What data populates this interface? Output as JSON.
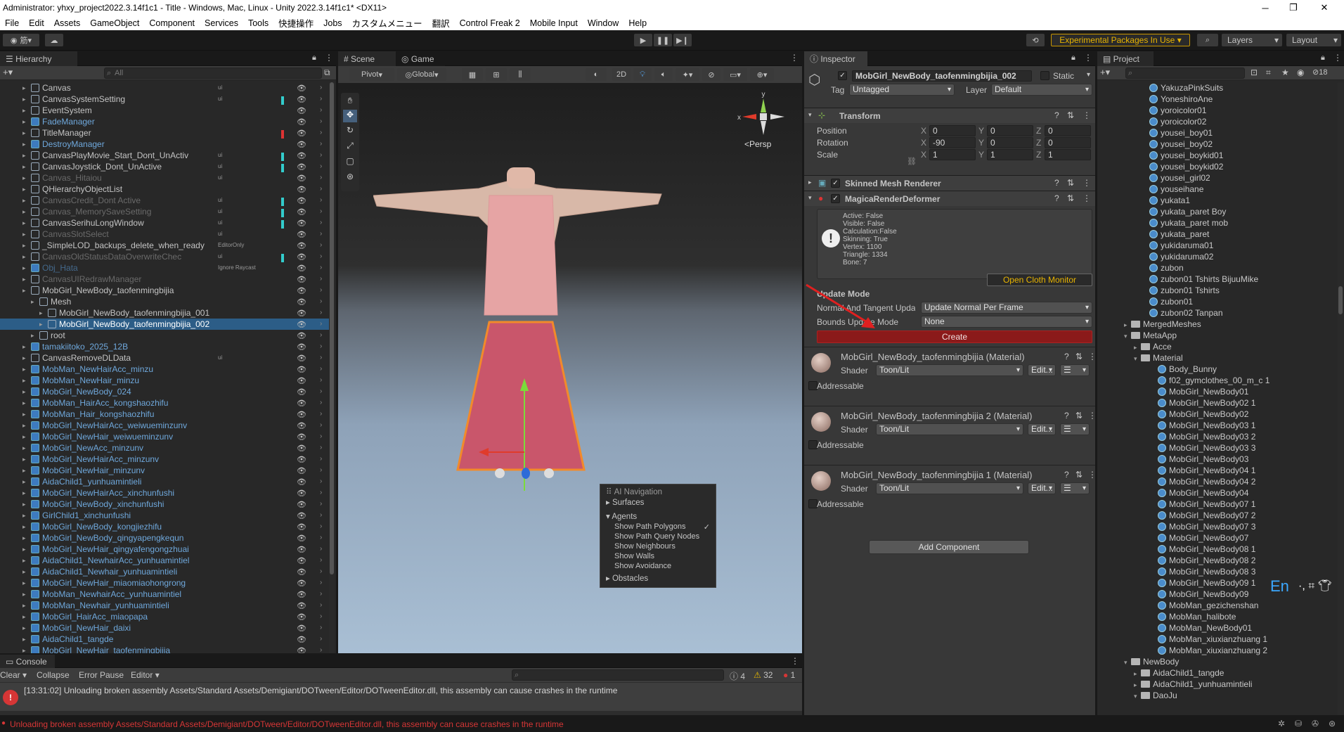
{
  "window": {
    "title": "Administrator: yhxy_project2022.3.14f1c1 - Title - Windows, Mac, Linux - Unity 2022.3.14f1c1* <DX11>"
  },
  "menu": [
    "File",
    "Edit",
    "Assets",
    "GameObject",
    "Component",
    "Services",
    "Tools",
    "快捷操作",
    "Jobs",
    "カスタムメニュー",
    "翻訳",
    "Control Freak 2",
    "Mobile Input",
    "Window",
    "Help"
  ],
  "toolbar": {
    "experimental": "Experimental Packages In Use",
    "layers": "Layers",
    "layout": "Layout",
    "account": "筋"
  },
  "hierarchy": {
    "tab": "Hierarchy",
    "search_placeholder": "All",
    "rows": [
      {
        "label": "Canvas",
        "indent": 0,
        "style": "normal",
        "tag": "ui",
        "bar": ""
      },
      {
        "label": "CanvasSystemSetting",
        "indent": 0,
        "style": "normal",
        "tag": "ui",
        "bar": "#3cc"
      },
      {
        "label": "EventSystem",
        "indent": 0,
        "style": "normal",
        "tag": "",
        "bar": ""
      },
      {
        "label": "FadeManager",
        "indent": 0,
        "style": "prefab",
        "tag": "",
        "bar": ""
      },
      {
        "label": "TitleManager",
        "indent": 0,
        "style": "normal",
        "tag": "",
        "bar": "#d33"
      },
      {
        "label": "DestroyManager",
        "indent": 0,
        "style": "prefab",
        "tag": "",
        "bar": ""
      },
      {
        "label": "CanvasPlayMovie_Start_Dont_UnActiv",
        "indent": 0,
        "style": "normal",
        "tag": "ui",
        "bar": "#3cc"
      },
      {
        "label": "CanvasJoystick_Dont_UnActive",
        "indent": 0,
        "style": "normal",
        "tag": "ui",
        "bar": "#3cc"
      },
      {
        "label": "Canvas_Hitaiou",
        "indent": 0,
        "style": "dim",
        "tag": "ui",
        "bar": ""
      },
      {
        "label": "QHierarchyObjectList",
        "indent": 0,
        "style": "normal",
        "tag": "",
        "bar": ""
      },
      {
        "label": "CanvasCredit_Dont Active",
        "indent": 0,
        "style": "dim",
        "tag": "ui",
        "bar": "#3cc"
      },
      {
        "label": "Canvas_MemorySaveSetting",
        "indent": 0,
        "style": "dim",
        "tag": "ui",
        "bar": "#3cc"
      },
      {
        "label": "CanvasSerihuLongWindow",
        "indent": 0,
        "style": "normal",
        "tag": "ui",
        "bar": "#3cc"
      },
      {
        "label": "CanvasSlotSelect",
        "indent": 0,
        "style": "dim",
        "tag": "ui",
        "bar": ""
      },
      {
        "label": "_SimpleLOD_backups_delete_when_ready",
        "indent": 0,
        "style": "normal",
        "tag": "EditorOnly",
        "bar": ""
      },
      {
        "label": "CanvasOldStatusDataOverwriteChec",
        "indent": 0,
        "style": "dim",
        "tag": "ui",
        "bar": "#3cc"
      },
      {
        "label": "Obj_Hata",
        "indent": 0,
        "style": "dimblue",
        "tag": "Ignore Raycast",
        "bar": ""
      },
      {
        "label": "CanvasUIRedrawManager",
        "indent": 0,
        "style": "dim",
        "tag": "",
        "bar": ""
      },
      {
        "label": "MobGirl_NewBody_taofenmingbijia",
        "indent": 0,
        "style": "normal",
        "tag": "",
        "bar": ""
      },
      {
        "label": "Mesh",
        "indent": 1,
        "style": "normal",
        "tag": "",
        "bar": ""
      },
      {
        "label": "MobGirl_NewBody_taofenmingbijia_001",
        "indent": 2,
        "style": "normal",
        "tag": "",
        "bar": ""
      },
      {
        "label": "MobGirl_NewBody_taofenmingbijia_002",
        "indent": 2,
        "style": "selected",
        "tag": "",
        "bar": ""
      },
      {
        "label": "root",
        "indent": 1,
        "style": "normal",
        "tag": "",
        "bar": ""
      },
      {
        "label": "tamakiitoko_2025_12B",
        "indent": 0,
        "style": "prefab",
        "tag": "",
        "bar": ""
      },
      {
        "label": "CanvasRemoveDLData",
        "indent": 0,
        "style": "normal",
        "tag": "ui",
        "bar": ""
      },
      {
        "label": "MobMan_NewHairAcc_minzu",
        "indent": 0,
        "style": "prefab",
        "tag": "",
        "bar": ""
      },
      {
        "label": "MobMan_NewHair_minzu",
        "indent": 0,
        "style": "prefab",
        "tag": "",
        "bar": ""
      },
      {
        "label": "MobGirl_NewBody_024",
        "indent": 0,
        "style": "prefab",
        "tag": "",
        "bar": ""
      },
      {
        "label": "MobMan_HairAcc_kongshaozhifu",
        "indent": 0,
        "style": "prefab",
        "tag": "",
        "bar": ""
      },
      {
        "label": "MobMan_Hair_kongshaozhifu",
        "indent": 0,
        "style": "prefab",
        "tag": "",
        "bar": ""
      },
      {
        "label": "MobGirl_NewHairAcc_weiwueminzunv",
        "indent": 0,
        "style": "prefab",
        "tag": "",
        "bar": ""
      },
      {
        "label": "MobGirl_NewHair_weiwueminzunv",
        "indent": 0,
        "style": "prefab",
        "tag": "",
        "bar": ""
      },
      {
        "label": "MobGirl_NewAcc_minzunv",
        "indent": 0,
        "style": "prefab",
        "tag": "",
        "bar": ""
      },
      {
        "label": "MobGirl_NewHairAcc_minzunv",
        "indent": 0,
        "style": "prefab",
        "tag": "",
        "bar": ""
      },
      {
        "label": "MobGirl_NewHair_minzunv",
        "indent": 0,
        "style": "prefab",
        "tag": "",
        "bar": ""
      },
      {
        "label": "AidaChild1_yunhuamintieli",
        "indent": 0,
        "style": "prefab",
        "tag": "",
        "bar": ""
      },
      {
        "label": "MobGirl_NewHairAcc_xinchunfushi",
        "indent": 0,
        "style": "prefab",
        "tag": "",
        "bar": ""
      },
      {
        "label": "MobGirl_NewBody_xinchunfushi",
        "indent": 0,
        "style": "prefab",
        "tag": "",
        "bar": ""
      },
      {
        "label": "GirlChild1_xinchunfushi",
        "indent": 0,
        "style": "prefab",
        "tag": "",
        "bar": ""
      },
      {
        "label": "MobGirl_NewBody_kongjiezhifu",
        "indent": 0,
        "style": "prefab",
        "tag": "",
        "bar": ""
      },
      {
        "label": "MobGirl_NewBody_qingyapengkequn",
        "indent": 0,
        "style": "prefab",
        "tag": "",
        "bar": ""
      },
      {
        "label": "MobGirl_NewHair_qingyafengongzhuai",
        "indent": 0,
        "style": "prefab",
        "tag": "",
        "bar": ""
      },
      {
        "label": "AidaChild1_NewhairAcc_yunhuamintiel",
        "indent": 0,
        "style": "prefab",
        "tag": "",
        "bar": ""
      },
      {
        "label": "AidaChild1_Newhair_yunhuamintieli",
        "indent": 0,
        "style": "prefab",
        "tag": "",
        "bar": ""
      },
      {
        "label": "MobGirl_NewHair_miaomiaohongrong",
        "indent": 0,
        "style": "prefab",
        "tag": "",
        "bar": ""
      },
      {
        "label": "MobMan_NewhairAcc_yunhuamintiel",
        "indent": 0,
        "style": "prefab",
        "tag": "",
        "bar": ""
      },
      {
        "label": "MobMan_Newhair_yunhuamintieli",
        "indent": 0,
        "style": "prefab",
        "tag": "",
        "bar": ""
      },
      {
        "label": "MobGirl_HairAcc_miaopapa",
        "indent": 0,
        "style": "prefab",
        "tag": "",
        "bar": ""
      },
      {
        "label": "MobGirl_NewHair_daixi",
        "indent": 0,
        "style": "prefab",
        "tag": "",
        "bar": ""
      },
      {
        "label": "AidaChild1_tangde",
        "indent": 0,
        "style": "prefab",
        "tag": "",
        "bar": ""
      },
      {
        "label": "MobGirl_NewHair_taofenmingbijia",
        "indent": 0,
        "style": "prefab",
        "tag": "",
        "bar": ""
      }
    ]
  },
  "scene": {
    "tabs": [
      "Scene",
      "Game"
    ],
    "pivot": "Pivot",
    "global": "Global",
    "mode_2d": "2D",
    "persp": "<Persp",
    "nav_overlay": {
      "title": "AI Navigation",
      "surfaces": "Surfaces",
      "agents": "Agents",
      "items": [
        "Show Path Polygons",
        "Show Path Query Nodes",
        "Show Neighbours",
        "Show Walls",
        "Show Avoidance"
      ],
      "obstacles": "Obstacles"
    }
  },
  "inspector": {
    "tab": "Inspector",
    "object_name": "MobGirl_NewBody_taofenmingbijia_002",
    "static": "Static",
    "tag_label": "Tag",
    "tag_value": "Untagged",
    "layer_label": "Layer",
    "layer_value": "Default",
    "transform": {
      "title": "Transform",
      "rows": [
        {
          "label": "Position",
          "x": "0",
          "y": "0",
          "z": "0"
        },
        {
          "label": "Rotation",
          "x": "-90",
          "y": "0",
          "z": "0"
        },
        {
          "label": "Scale",
          "x": "1",
          "y": "1",
          "z": "1"
        }
      ]
    },
    "skinned": "Skinned Mesh Renderer",
    "magica": "MagicaRenderDeformer",
    "status_lines": [
      "Active: False",
      "Visible: False",
      "Calculation:False",
      "Skinning: True",
      "Vertex: 1100",
      "Triangle: 1334",
      "Bone: 7"
    ],
    "open_cloth": "Open Cloth Monitor",
    "update_mode": "Update Mode",
    "normal_label": "Normal And Tangent Upda",
    "normal_value": "Update Normal Per Frame",
    "bounds_label": "Bounds Update Mode",
    "bounds_value": "None",
    "create": "Create",
    "materials": [
      {
        "name": "MobGirl_NewBody_taofenmingbijia (Material)",
        "shader": "Toon/Lit"
      },
      {
        "name": "MobGirl_NewBody_taofenmingbijia 2 (Material)",
        "shader": "Toon/Lit"
      },
      {
        "name": "MobGirl_NewBody_taofenmingbijia 1 (Material)",
        "shader": "Toon/Lit"
      }
    ],
    "shader_label": "Shader",
    "edit": "Edit...",
    "addressable": "Addressable",
    "add_component": "Add Component"
  },
  "project": {
    "tab": "Project",
    "count": "18",
    "items": [
      {
        "label": "YakuzaPinkSuits",
        "type": "asset",
        "indent": 2
      },
      {
        "label": "YoneshiroAne",
        "type": "asset",
        "indent": 2
      },
      {
        "label": "yoroicolor01",
        "type": "asset",
        "indent": 2
      },
      {
        "label": "yoroicolor02",
        "type": "asset",
        "indent": 2
      },
      {
        "label": "yousei_boy01",
        "type": "asset",
        "indent": 2
      },
      {
        "label": "yousei_boy02",
        "type": "asset",
        "indent": 2
      },
      {
        "label": "yousei_boykid01",
        "type": "asset",
        "indent": 2
      },
      {
        "label": "yousei_boykid02",
        "type": "asset",
        "indent": 2
      },
      {
        "label": "yousei_girl02",
        "type": "asset",
        "indent": 2
      },
      {
        "label": "youseihane",
        "type": "asset",
        "indent": 2
      },
      {
        "label": "yukata1",
        "type": "asset",
        "indent": 2
      },
      {
        "label": "yukata_paret Boy",
        "type": "asset",
        "indent": 2
      },
      {
        "label": "yukata_paret mob",
        "type": "asset",
        "indent": 2
      },
      {
        "label": "yukata_paret",
        "type": "asset",
        "indent": 2
      },
      {
        "label": "yukidaruma01",
        "type": "asset",
        "indent": 2
      },
      {
        "label": "yukidaruma02",
        "type": "asset",
        "indent": 2
      },
      {
        "label": "zubon",
        "type": "asset",
        "indent": 2
      },
      {
        "label": "zubon01 Tshirts BijuuMike",
        "type": "asset",
        "indent": 2
      },
      {
        "label": "zubon01 Tshirts",
        "type": "asset",
        "indent": 2
      },
      {
        "label": "zubon01",
        "type": "asset",
        "indent": 2
      },
      {
        "label": "zubon02 Tanpan",
        "type": "asset",
        "indent": 2
      },
      {
        "label": "MergedMeshes",
        "type": "folder-closed",
        "indent": 0
      },
      {
        "label": "MetaApp",
        "type": "folder-open",
        "indent": 0
      },
      {
        "label": "Acce",
        "type": "folder-closed",
        "indent": 1
      },
      {
        "label": "Material",
        "type": "folder-open",
        "indent": 1
      },
      {
        "label": "Body_Bunny",
        "type": "asset",
        "indent": 3
      },
      {
        "label": "f02_gymclothes_00_m_c 1",
        "type": "asset",
        "indent": 3
      },
      {
        "label": "MobGirl_NewBody01",
        "type": "asset",
        "indent": 3
      },
      {
        "label": "MobGirl_NewBody02 1",
        "type": "asset",
        "indent": 3
      },
      {
        "label": "MobGirl_NewBody02",
        "type": "asset",
        "indent": 3
      },
      {
        "label": "MobGirl_NewBody03 1",
        "type": "asset",
        "indent": 3
      },
      {
        "label": "MobGirl_NewBody03 2",
        "type": "asset",
        "indent": 3
      },
      {
        "label": "MobGirl_NewBody03 3",
        "type": "asset",
        "indent": 3
      },
      {
        "label": "MobGirl_NewBody03",
        "type": "asset",
        "indent": 3
      },
      {
        "label": "MobGirl_NewBody04 1",
        "type": "asset",
        "indent": 3
      },
      {
        "label": "MobGirl_NewBody04 2",
        "type": "asset",
        "indent": 3
      },
      {
        "label": "MobGirl_NewBody04",
        "type": "asset",
        "indent": 3
      },
      {
        "label": "MobGirl_NewBody07 1",
        "type": "asset",
        "indent": 3
      },
      {
        "label": "MobGirl_NewBody07 2",
        "type": "asset",
        "indent": 3
      },
      {
        "label": "MobGirl_NewBody07 3",
        "type": "asset",
        "indent": 3
      },
      {
        "label": "MobGirl_NewBody07",
        "type": "asset",
        "indent": 3
      },
      {
        "label": "MobGirl_NewBody08 1",
        "type": "asset",
        "indent": 3
      },
      {
        "label": "MobGirl_NewBody08 2",
        "type": "asset",
        "indent": 3
      },
      {
        "label": "MobGirl_NewBody08 3",
        "type": "asset",
        "indent": 3
      },
      {
        "label": "MobGirl_NewBody09 1",
        "type": "asset",
        "indent": 3
      },
      {
        "label": "MobGirl_NewBody09",
        "type": "asset",
        "indent": 3
      },
      {
        "label": "MobMan_gezichenshan",
        "type": "asset",
        "indent": 3
      },
      {
        "label": "MobMan_halibote",
        "type": "asset",
        "indent": 3
      },
      {
        "label": "MobMan_NewBody01",
        "type": "asset",
        "indent": 3
      },
      {
        "label": "MobMan_xiuxianzhuang 1",
        "type": "asset",
        "indent": 3
      },
      {
        "label": "MobMan_xiuxianzhuang 2",
        "type": "asset",
        "indent": 3
      },
      {
        "label": "NewBody",
        "type": "folder-open",
        "indent": 0
      },
      {
        "label": "AidaChild1_tangde",
        "type": "folder-closed",
        "indent": 1
      },
      {
        "label": "AidaChild1_yunhuamintieli",
        "type": "folder-closed",
        "indent": 1
      },
      {
        "label": "DaoJu",
        "type": "folder-open",
        "indent": 1
      }
    ],
    "ime": "En"
  },
  "console": {
    "tab": "Console",
    "clear": "Clear",
    "collapse": "Collapse",
    "error_pause": "Error Pause",
    "editor": "Editor",
    "count_info": "4",
    "count_warn": "32",
    "count_err": "1",
    "message": "[13:31:02] Unloading broken assembly Assets/Standard Assets/Demigiant/DOTween/Editor/DOTweenEditor.dll, this assembly can cause crashes in the runtime",
    "status": "Unloading broken assembly Assets/Standard Assets/Demigiant/DOTween/Editor/DOTweenEditor.dll, this assembly can cause crashes in the runtime"
  },
  "colors": {
    "accent_selected": "#2c5d87",
    "create_button": "#8b1a1a",
    "prefab_text": "#6fa8dc",
    "error": "#d63636",
    "warning": "#e6b800"
  }
}
